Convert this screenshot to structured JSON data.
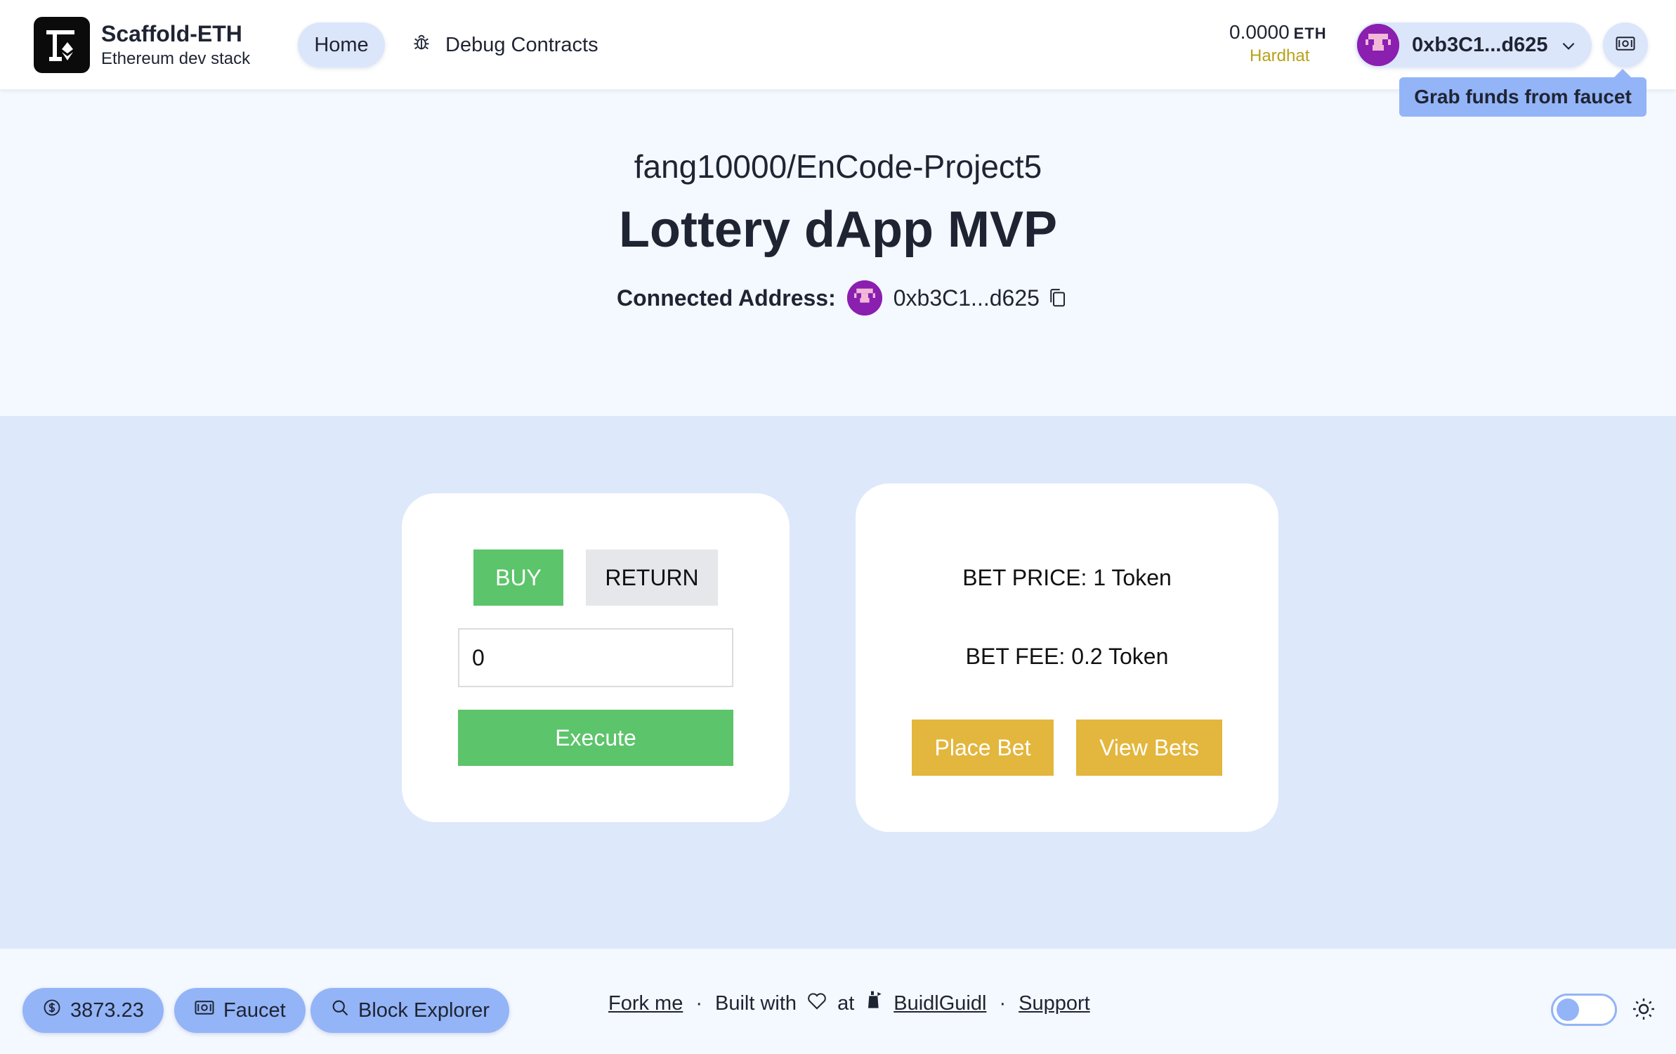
{
  "header": {
    "brand_title": "Scaffold-ETH",
    "brand_subtitle": "Ethereum dev stack",
    "nav": {
      "home": "Home",
      "debug": "Debug Contracts"
    },
    "balance": {
      "amount": "0.0000",
      "unit": "ETH",
      "network": "Hardhat"
    },
    "account_address": "0xb3C1...d625",
    "faucet_tooltip": "Grab funds from faucet"
  },
  "hero": {
    "repo": "fang10000/EnCode-Project5",
    "title": "Lottery dApp MVP",
    "connected_label": "Connected Address:",
    "connected_address": "0xb3C1...d625"
  },
  "token_card": {
    "buy_label": "BUY",
    "return_label": "RETURN",
    "amount_value": "0",
    "execute_label": "Execute"
  },
  "bet_card": {
    "price_text": "BET PRICE: 1 Token",
    "fee_text": "BET FEE: 0.2 Token",
    "place_label": "Place Bet",
    "view_label": "View Bets"
  },
  "footer": {
    "eth_price": "3873.23",
    "faucet_label": "Faucet",
    "explorer_label": "Block Explorer",
    "fork_label": "Fork me",
    "built_with": "Built with",
    "at_label": "at",
    "buidl_label": "BuidlGuidl",
    "support_label": "Support"
  },
  "colors": {
    "green": "#5cc46a",
    "gold": "#e3b63d",
    "accent_blue": "#93b4f7",
    "pill_blue": "#dbe6fb",
    "band_blue": "#dde8fb",
    "network_yellow": "#b8a219",
    "avatar_purple": "#8a1fb0"
  },
  "icons": {
    "logo": "scaffold-eth-logo-icon",
    "debug": "bug-icon",
    "chevron": "chevron-down-icon",
    "faucet": "banknote-icon",
    "copy": "copy-icon",
    "price": "dollar-circle-icon",
    "search": "search-icon",
    "heart": "heart-icon",
    "buidl": "castle-icon",
    "theme": "sun-icon"
  }
}
